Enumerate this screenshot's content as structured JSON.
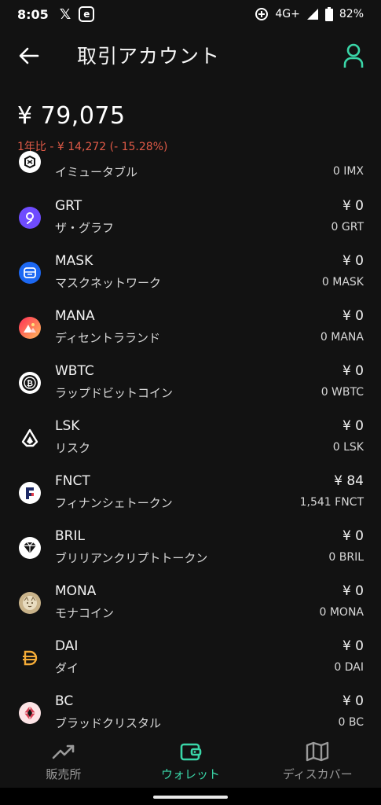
{
  "status_bar": {
    "time": "8:05",
    "network": "4G+",
    "battery": "82%"
  },
  "header": {
    "title": "取引アカウント"
  },
  "summary": {
    "balance": "¥ 79,075",
    "change": "1年比 - ¥ 14,272 (- 15.28%)"
  },
  "coins": [
    {
      "symbol": "IMX",
      "name": "イミュータブル",
      "value": "",
      "amount": "0 IMX",
      "icon": "imx-icon",
      "color": "#ffffff"
    },
    {
      "symbol": "GRT",
      "name": "ザ・グラフ",
      "value": "¥ 0",
      "amount": "0 GRT",
      "icon": "grt-icon",
      "color": "#6f4cff"
    },
    {
      "symbol": "MASK",
      "name": "マスクネットワーク",
      "value": "¥ 0",
      "amount": "0 MASK",
      "icon": "mask-icon",
      "color": "#1c68f3"
    },
    {
      "symbol": "MANA",
      "name": "ディセントラランド",
      "value": "¥ 0",
      "amount": "0 MANA",
      "icon": "mana-icon",
      "color": "#ff5a5f"
    },
    {
      "symbol": "WBTC",
      "name": "ラップドビットコイン",
      "value": "¥ 0",
      "amount": "0 WBTC",
      "icon": "wbtc-icon",
      "color": "#ffffff"
    },
    {
      "symbol": "LSK",
      "name": "リスク",
      "value": "¥ 0",
      "amount": "0 LSK",
      "icon": "lsk-icon",
      "color": "#121212"
    },
    {
      "symbol": "FNCT",
      "name": "フィナンシェトークン",
      "value": "¥ 84",
      "amount": "1,541 FNCT",
      "icon": "fnct-icon",
      "color": "#ffffff"
    },
    {
      "symbol": "BRIL",
      "name": "ブリリアンクリプトトークン",
      "value": "¥ 0",
      "amount": "0 BRIL",
      "icon": "bril-icon",
      "color": "#ffffff"
    },
    {
      "symbol": "MONA",
      "name": "モナコイン",
      "value": "¥ 0",
      "amount": "0 MONA",
      "icon": "mona-icon",
      "color": "#c9b38a"
    },
    {
      "symbol": "DAI",
      "name": "ダイ",
      "value": "¥ 0",
      "amount": "0 DAI",
      "icon": "dai-icon",
      "color": "#f5ac37"
    },
    {
      "symbol": "BC",
      "name": "ブラッドクリスタル",
      "value": "¥ 0",
      "amount": "0 BC",
      "icon": "bc-icon",
      "color": "#fde4e6"
    }
  ],
  "nav": [
    {
      "label": "販売所",
      "icon": "trend-icon"
    },
    {
      "label": "ウォレット",
      "icon": "wallet-icon"
    },
    {
      "label": "ディスカバー",
      "icon": "map-icon"
    }
  ],
  "colors": {
    "accent": "#3ad6a8",
    "negative": "#e05a47",
    "background": "#121212"
  }
}
